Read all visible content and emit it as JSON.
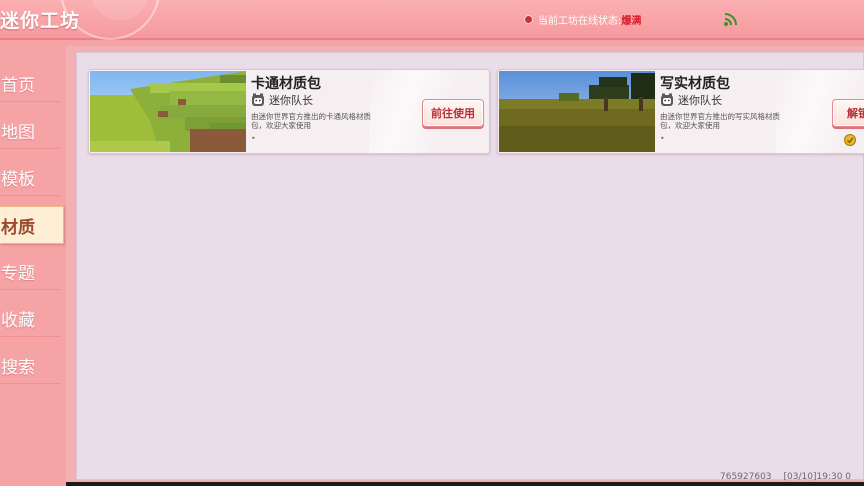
{
  "header": {
    "app_title": "迷你工坊",
    "status_label": "当前工坊在线状态:",
    "status_value": "爆满",
    "status_color": "#d8202c",
    "signal_icon": "signal-icon"
  },
  "sidebar": {
    "items": [
      {
        "label": "首页"
      },
      {
        "label": "地图"
      },
      {
        "label": "模板"
      },
      {
        "label": "材质",
        "active": true
      },
      {
        "label": "专题"
      },
      {
        "label": "收藏"
      },
      {
        "label": "搜索"
      }
    ]
  },
  "cards": [
    {
      "title": "卡通材质包",
      "author": "迷你队长",
      "description": "由迷你世界官方推出的卡通风格材质包，欢迎大家使用",
      "dot": "•",
      "button": "前往使用"
    },
    {
      "title": "写实材质包",
      "author": "迷你队长",
      "description": "由迷你世界官方推出的写实风格材质包，欢迎大家使用",
      "dot": "•",
      "button": "解锁"
    }
  ],
  "footer": {
    "id": "765927603",
    "time": "[03/10]19:30 0"
  },
  "colors": {
    "accent": "#f6a3a6",
    "panel": "#ebdcea",
    "button_text": "#b5313b"
  }
}
